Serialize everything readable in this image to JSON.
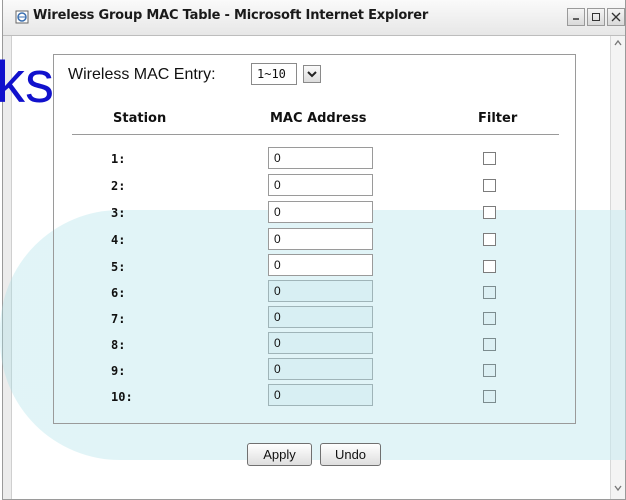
{
  "window": {
    "title": "Wireless Group MAC Table - Microsoft Internet Explorer"
  },
  "watermark": {
    "text": "ks"
  },
  "entry": {
    "label": "Wireless MAC Entry:",
    "selected": "1~10"
  },
  "table": {
    "headers": {
      "station": "Station",
      "mac": "MAC Address",
      "filter": "Filter"
    },
    "rows": [
      {
        "station": "1:",
        "mac": "0",
        "filter": false,
        "shaded": false
      },
      {
        "station": "2:",
        "mac": "0",
        "filter": false,
        "shaded": false
      },
      {
        "station": "3:",
        "mac": "0",
        "filter": false,
        "shaded": false
      },
      {
        "station": "4:",
        "mac": "0",
        "filter": false,
        "shaded": false
      },
      {
        "station": "5:",
        "mac": "0",
        "filter": false,
        "shaded": false
      },
      {
        "station": "6:",
        "mac": "0",
        "filter": false,
        "shaded": true
      },
      {
        "station": "7:",
        "mac": "0",
        "filter": false,
        "shaded": true
      },
      {
        "station": "8:",
        "mac": "0",
        "filter": false,
        "shaded": true
      },
      {
        "station": "9:",
        "mac": "0",
        "filter": false,
        "shaded": true
      },
      {
        "station": "10:",
        "mac": "0",
        "filter": false,
        "shaded": true
      }
    ]
  },
  "buttons": {
    "apply": "Apply",
    "undo": "Undo"
  },
  "icons": {
    "window": "ie-page-icon",
    "minimize": "minimize-icon",
    "maximize": "maximize-icon",
    "close": "close-icon",
    "select_arrow": "chevron-down-icon"
  },
  "colors": {
    "accent_text": "#1111cc",
    "background_stripe": "#aee1e8"
  }
}
